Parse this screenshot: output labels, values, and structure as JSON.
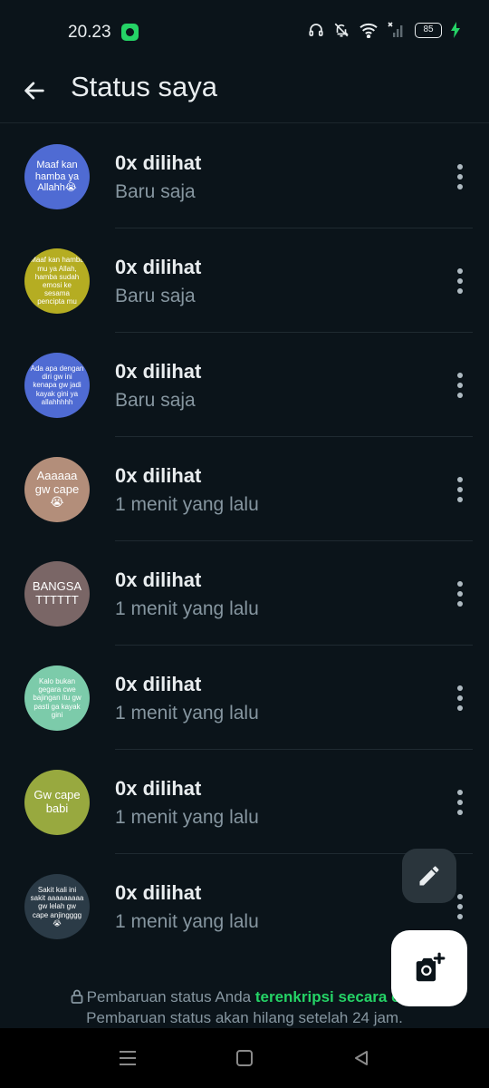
{
  "status_bar": {
    "time": "20.23",
    "battery": "85"
  },
  "app_bar": {
    "title": "Status saya"
  },
  "statuses": [
    {
      "text": "Maaf kan hamba ya Allahh😭",
      "bg": "#4f6bd3",
      "views": "0x dilihat",
      "time": "Baru saja"
    },
    {
      "text": "Maaf kan hamba mu ya Allah, hamba sudah emosi ke sesama pencipta mu",
      "bg": "#b5ad22",
      "views": "0x dilihat",
      "time": "Baru saja"
    },
    {
      "text": "Ada apa dengan diri gw ini kenapa gw jadi kayak gini ya allahhhhh",
      "bg": "#4f6bd3",
      "views": "0x dilihat",
      "time": "Baru saja"
    },
    {
      "text": "Aaaaaa gw cape 😭",
      "bg": "#b38e7a",
      "views": "0x dilihat",
      "time": "1 menit yang lalu"
    },
    {
      "text": "BANGSATTTTTT",
      "bg": "#7a6666",
      "views": "0x dilihat",
      "time": "1 menit yang lalu"
    },
    {
      "text": "Kalo bukan gegara cwe bajingan itu gw pasti ga kayak gini",
      "bg": "#7ccbaa",
      "views": "0x dilihat",
      "time": "1 menit yang lalu"
    },
    {
      "text": "Gw cape babi",
      "bg": "#98a93f",
      "views": "0x dilihat",
      "time": "1 menit yang lalu"
    },
    {
      "text": "Sakit kali ini sakit aaaaaaaaa gw lelah gw cape anjingggg😭",
      "bg": "#2b3b47",
      "views": "0x dilihat",
      "time": "1 menit yang lalu"
    }
  ],
  "footer": {
    "prefix": "Pembaruan status Anda ",
    "encrypted": "terenkripsi secara end",
    "line2": "Pembaruan status akan hilang setelah 24 jam."
  },
  "icons": {
    "back": "arrow-left",
    "menu": "more-vertical",
    "edit": "pencil",
    "camera": "camera-plus",
    "lock": "lock"
  },
  "colors": {
    "background": "#0b141a",
    "accent": "#25d366",
    "secondary_text": "#8696a0"
  }
}
